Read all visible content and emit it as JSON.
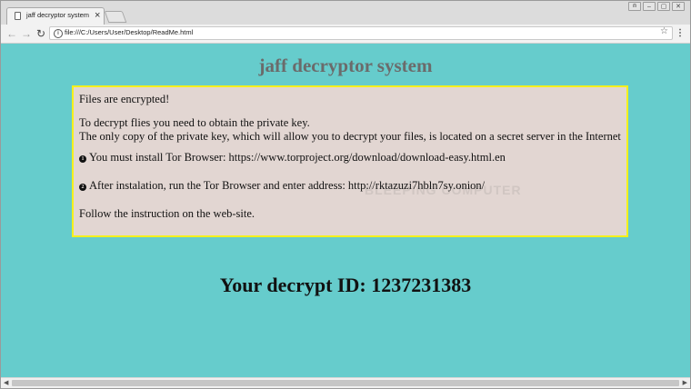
{
  "browser": {
    "tab_title": "jaff decryptor system",
    "tab_close": "×",
    "url": "file:///C:/Users/User/Desktop/ReadMe.html",
    "window_controls": [
      "⍝",
      "–",
      "▢",
      "✕"
    ]
  },
  "page": {
    "heading": "jaff decryptor system",
    "line1": "Files are encrypted!",
    "line2": "To decrypt flies you need to obtain the private key.",
    "line3": "The only copy of the private key, which will allow you to decrypt your files, is located on a secret server in the Internet",
    "step1_num": "1",
    "step1": "You must install Tor Browser: https://www.torproject.org/download/download-easy.html.en",
    "step2_num": "2",
    "step2": "After instalation, run the Tor Browser and enter address: http://rktazuzi7hbln7sy.onion/",
    "line_follow": "Follow the instruction on the web-site.",
    "decrypt_id": "Your decrypt ID: 1237231383",
    "watermark": "BLEEPING COMPUTER"
  },
  "colors": {
    "background": "#66cccc",
    "notice_background": "#e2d6d2",
    "notice_border": "#f4f01c",
    "heading": "#6b6b6b"
  }
}
